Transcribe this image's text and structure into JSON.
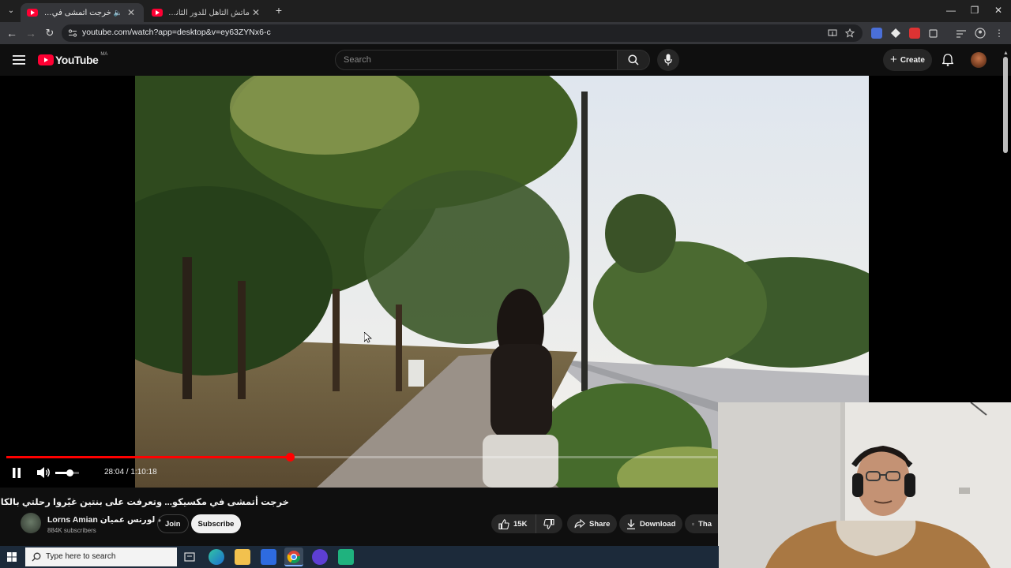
{
  "browser": {
    "tabs": [
      {
        "title": "خرجت أتمشى في مكسيكو...",
        "active": true
      },
      {
        "title": "ماتش التأهل للدور الثاني؟ التشك...",
        "active": false
      }
    ],
    "new_tab": "+",
    "url": "youtube.com/watch?app=desktop&v=ey63ZYNx6-c"
  },
  "youtube": {
    "logo": "YouTube",
    "region": "MA",
    "search_placeholder": "Search",
    "create_label": "Create"
  },
  "player": {
    "time_current": "28:04",
    "time_total": "1:10:18",
    "time_display": "28:04 / 1:10:18",
    "progress_fraction": 0.399,
    "volume_fraction": 0.6
  },
  "video": {
    "title": "خرجت أتمشى في مكسيكو... وتعرفت على بنتين غيّروا رحلتي بالكامل MX",
    "channel_name": "Lorns Amian لورنس عميان",
    "subscribers": "884K subscribers",
    "join_label": "Join",
    "subscribe_label": "Subscribe",
    "likes": "15K",
    "share_label": "Share",
    "download_label": "Download",
    "thanks_label": "Tha"
  },
  "taskbar": {
    "search_placeholder": "Type here to search"
  },
  "colors": {
    "youtube_red": "#ff0033",
    "progress_red": "#ff0000",
    "background": "#0f0f0f"
  }
}
